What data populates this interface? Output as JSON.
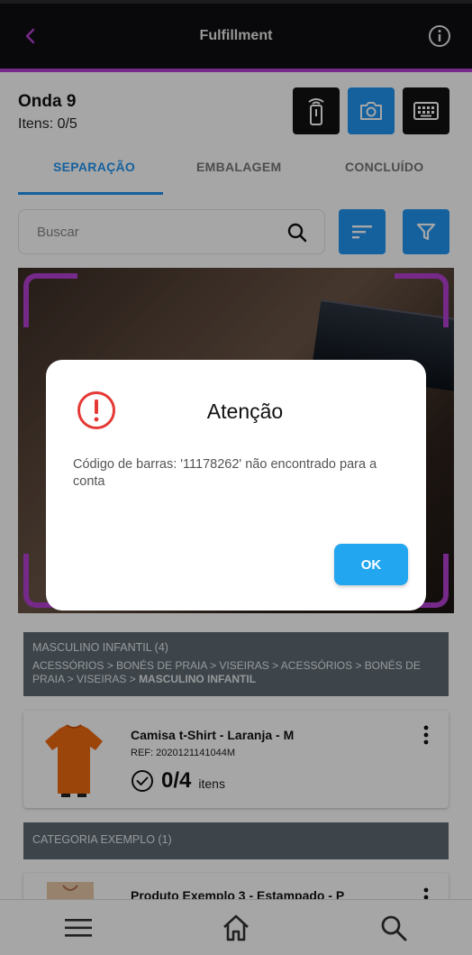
{
  "app": {
    "title": "Fulfillment"
  },
  "wave": {
    "title": "Onda 9",
    "items": "Itens: 0/5"
  },
  "tabs": [
    {
      "label": "SEPARAÇÃO",
      "active": true
    },
    {
      "label": "EMBALAGEM",
      "active": false
    },
    {
      "label": "CONCLUÍDO",
      "active": false
    }
  ],
  "search": {
    "placeholder": "Buscar"
  },
  "categories": [
    {
      "title": "MASCULINO INFANTIL (4)",
      "path": "ACESSÓRIOS > BONÉS DE PRAIA > VISEIRAS > ACESSÓRIOS > BONÉS DE PRAIA > VISEIRAS > ",
      "path_bold": "MASCULINO INFANTIL"
    },
    {
      "title": "CATEGORIA EXEMPLO (1)"
    }
  ],
  "products": [
    {
      "name": "Camisa t-Shirt  - Laranja - M",
      "ref": "REF: 2020121141044M",
      "count": "0/4",
      "unit": "itens"
    },
    {
      "name": "Produto Exemplo 3  - Estampado - P"
    }
  ],
  "dialog": {
    "title": "Atenção",
    "message": "Código de barras: '11178262' não encontrado para a conta",
    "ok_label": "OK"
  },
  "icons": {
    "back": "chevron-left-icon",
    "info": "info-icon",
    "scanner": "barcode-scanner-icon",
    "camera": "camera-icon",
    "keyboard": "keyboard-icon",
    "search": "search-icon",
    "sort": "sort-icon",
    "filter": "filter-icon",
    "alert": "alert-circle-icon",
    "menu": "menu-icon",
    "home": "home-icon"
  },
  "colors": {
    "accent": "#b440d2",
    "primary": "#2196f3",
    "appbar": "#0f0f12",
    "category_bg": "#5f6b74",
    "alert_red": "#e53935"
  }
}
